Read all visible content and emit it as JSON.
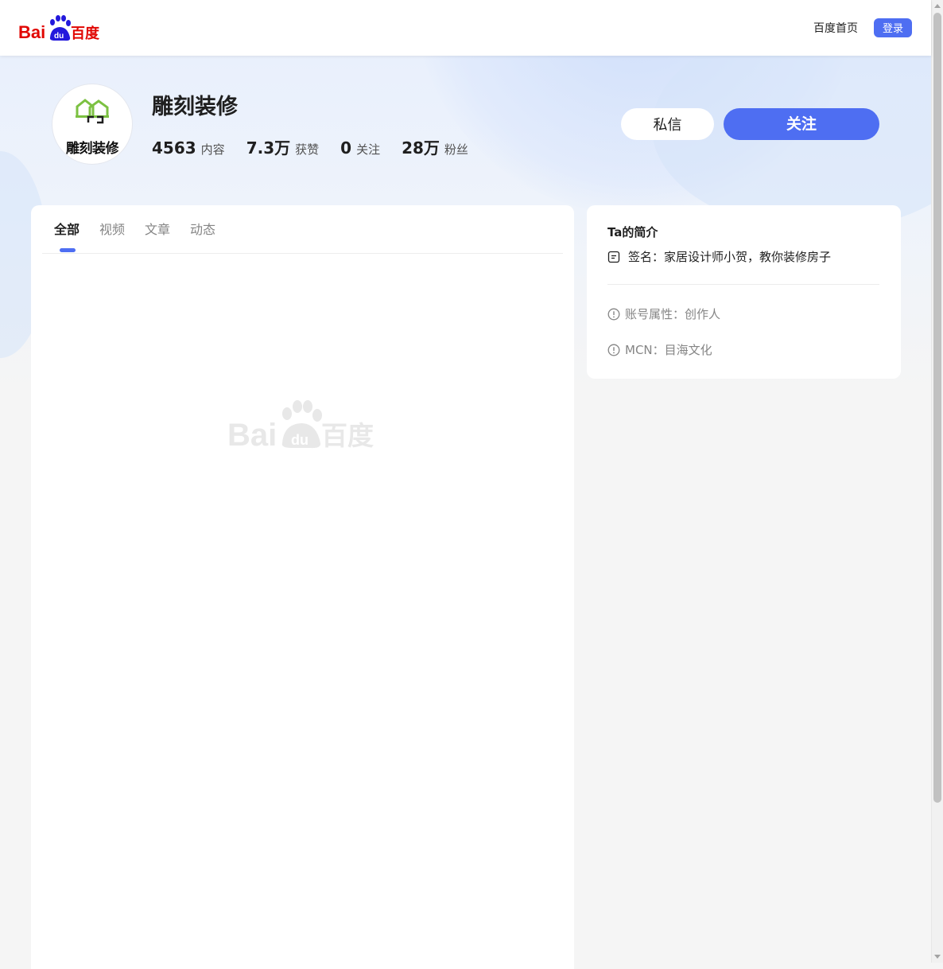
{
  "header": {
    "logo_text": "Bai百度",
    "home_link": "百度首页",
    "login_label": "登录"
  },
  "profile": {
    "name": "雕刻装修",
    "avatar_text": "雕刻装修",
    "stats": [
      {
        "value": "4563",
        "label": "内容"
      },
      {
        "value": "7.3万",
        "label": "获赞"
      },
      {
        "value": "0",
        "label": "关注"
      },
      {
        "value": "28万",
        "label": "粉丝"
      }
    ],
    "message_label": "私信",
    "follow_label": "关注"
  },
  "main": {
    "tabs": [
      {
        "label": "全部",
        "active": true
      },
      {
        "label": "视频",
        "active": false
      },
      {
        "label": "文章",
        "active": false
      },
      {
        "label": "动态",
        "active": false
      }
    ]
  },
  "side": {
    "title": "Ta的简介",
    "signature": "签名：家居设计师小贺，教你装修房子",
    "account_type": "账号属性：创作人",
    "mcn": "MCN：目海文化"
  },
  "colors": {
    "accent": "#4e6ef2",
    "baidu_red": "#e10602",
    "baidu_blue": "#2319dc"
  }
}
